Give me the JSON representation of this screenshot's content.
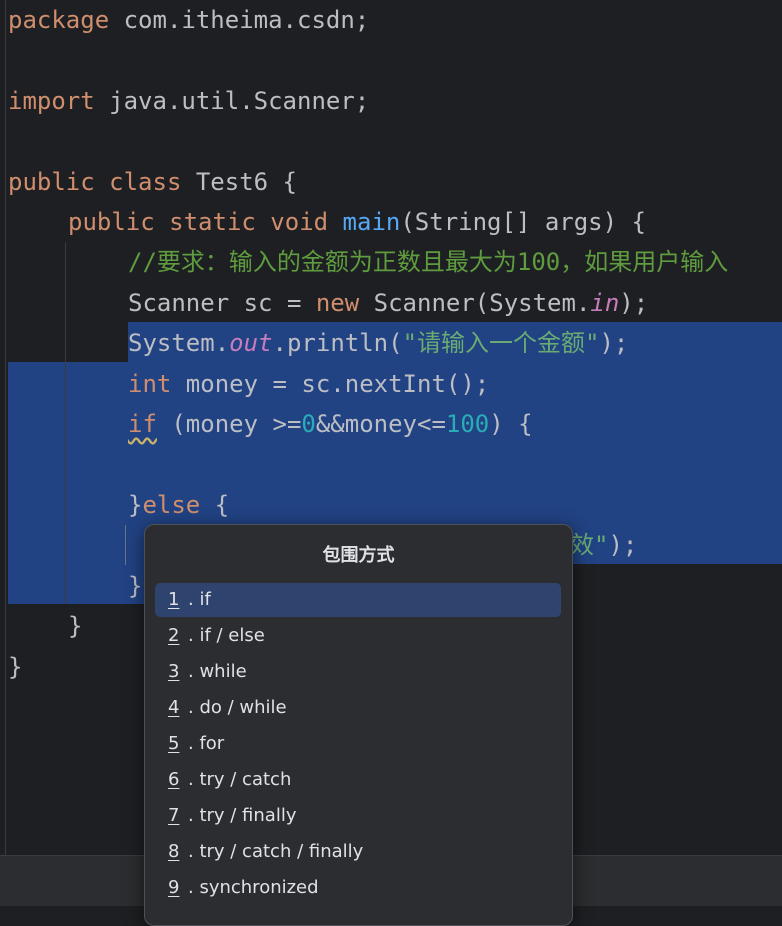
{
  "editor": {
    "lines": {
      "l1": {
        "kw": "package",
        "rest": " com.itheima.csdn;"
      },
      "l3": {
        "kw": "import",
        "rest": " java.util.Scanner;"
      },
      "l5": {
        "kw": "public class",
        "rest": " Test6 {"
      },
      "l6": {
        "kw": "public static void",
        "fn": "main",
        "rest": "(String[] args) {"
      },
      "l7": {
        "comment": "//要求：输入的金额为正数且最大为100，如果用户输入"
      },
      "l8": {
        "a": "Scanner sc = ",
        "kw": "new",
        "b": " Scanner(System.",
        "st": "in",
        "c": ");"
      },
      "l9": {
        "a": "System.",
        "st": "out",
        "b": ".println(",
        "str": "\"请输入一个金额\"",
        "c": ");"
      },
      "l10": {
        "kw": "int",
        "rest": " money = sc.nextInt();"
      },
      "l11": {
        "kw": "if",
        "a": " (money >=",
        "n1": "0",
        "b": "&&money<=",
        "n2": "100",
        "c": ") {"
      },
      "l13": {
        "a": "}",
        "kw": "else",
        "b": " {"
      },
      "l14": {
        "str": "效\"",
        "c": ");"
      },
      "l15": {
        "a": "}"
      },
      "l16": {
        "a": "}"
      },
      "l17": {
        "a": "}"
      }
    }
  },
  "popup": {
    "title": "包围方式",
    "items": [
      {
        "num": "1",
        "label": ". if"
      },
      {
        "num": "2",
        "label": ". if / else"
      },
      {
        "num": "3",
        "label": ". while"
      },
      {
        "num": "4",
        "label": ". do / while"
      },
      {
        "num": "5",
        "label": ". for"
      },
      {
        "num": "6",
        "label": ". try / catch"
      },
      {
        "num": "7",
        "label": ". try / finally"
      },
      {
        "num": "8",
        "label": ". try / catch / finally"
      },
      {
        "num": "9",
        "label": ". synchronized"
      }
    ]
  }
}
